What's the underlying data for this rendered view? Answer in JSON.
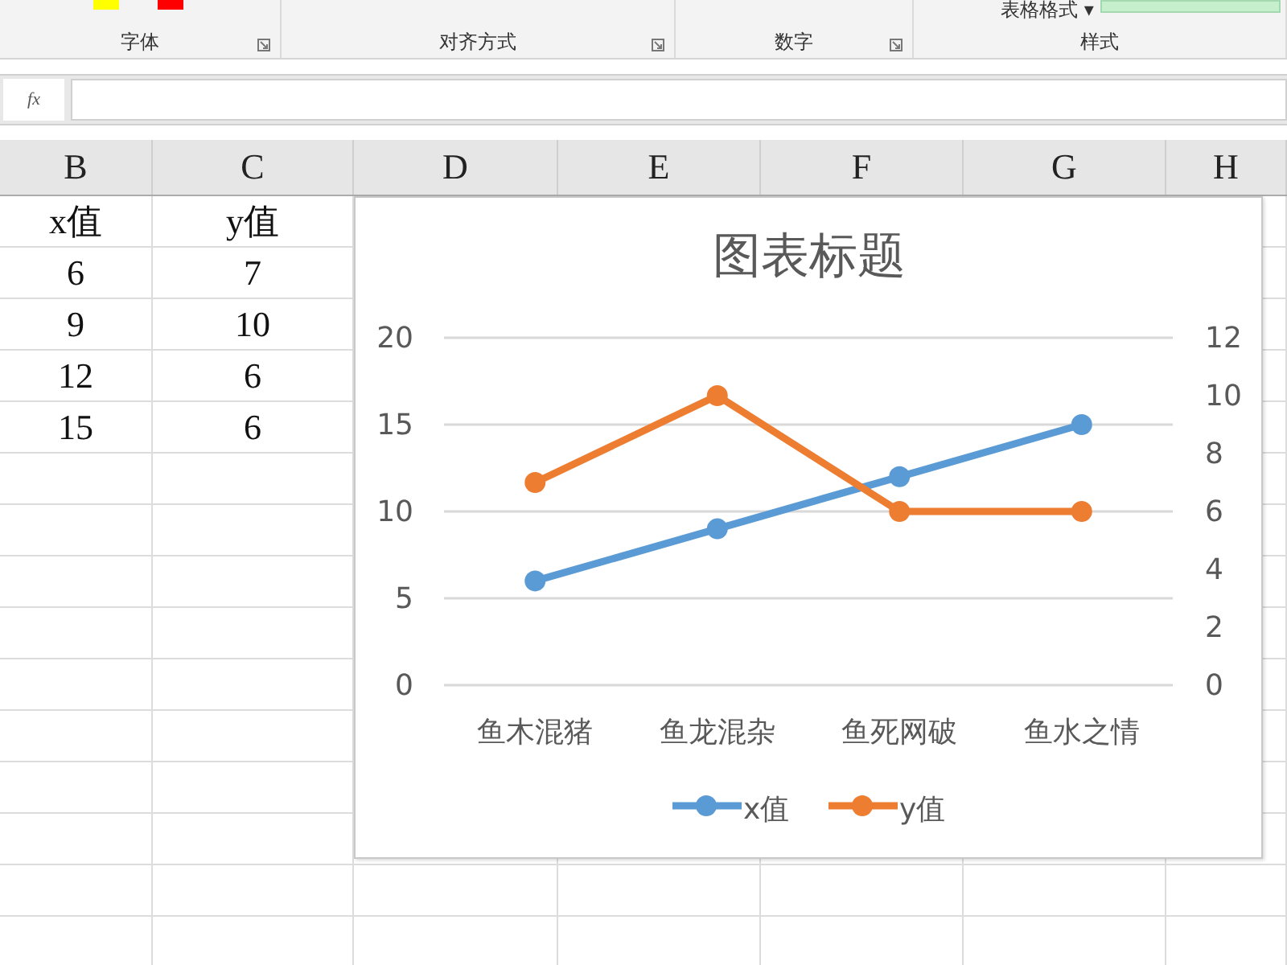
{
  "ribbon": {
    "groups": [
      {
        "label": "字体"
      },
      {
        "label": "对齐方式"
      },
      {
        "label": "数字"
      },
      {
        "label": "样式"
      }
    ],
    "table_format_button": "表格格式",
    "table_format_caret": "▾"
  },
  "formula_bar": {
    "function_label": "fx"
  },
  "sheet": {
    "columns": [
      "B",
      "C",
      "D",
      "E",
      "F",
      "G",
      "H"
    ],
    "rows": [
      [
        "x值",
        "y值"
      ],
      [
        "6",
        "7"
      ],
      [
        "9",
        "10"
      ],
      [
        "12",
        "6"
      ],
      [
        "15",
        "6"
      ]
    ]
  },
  "chart": {
    "chart_data": {
      "type": "line",
      "title": "图表标题",
      "categories": [
        "鱼木混猪",
        "鱼龙混杂",
        "鱼死网破",
        "鱼水之情"
      ],
      "series": [
        {
          "name": "x值",
          "color": "#5b9bd5",
          "values": [
            6,
            9,
            12,
            15
          ],
          "marker": "circle"
        },
        {
          "name": "y值",
          "color": "#ed7d31",
          "values": [
            7,
            10,
            6,
            6
          ],
          "axis": "y2",
          "marker": "circle"
        }
      ],
      "grid": true,
      "legend": "bottom",
      "ylim": [
        0,
        20
      ],
      "yticks": [
        0,
        5,
        10,
        15,
        20
      ],
      "y2lim": [
        0,
        12
      ],
      "y2ticks": [
        0,
        2,
        4,
        6,
        8,
        10,
        12
      ]
    }
  }
}
